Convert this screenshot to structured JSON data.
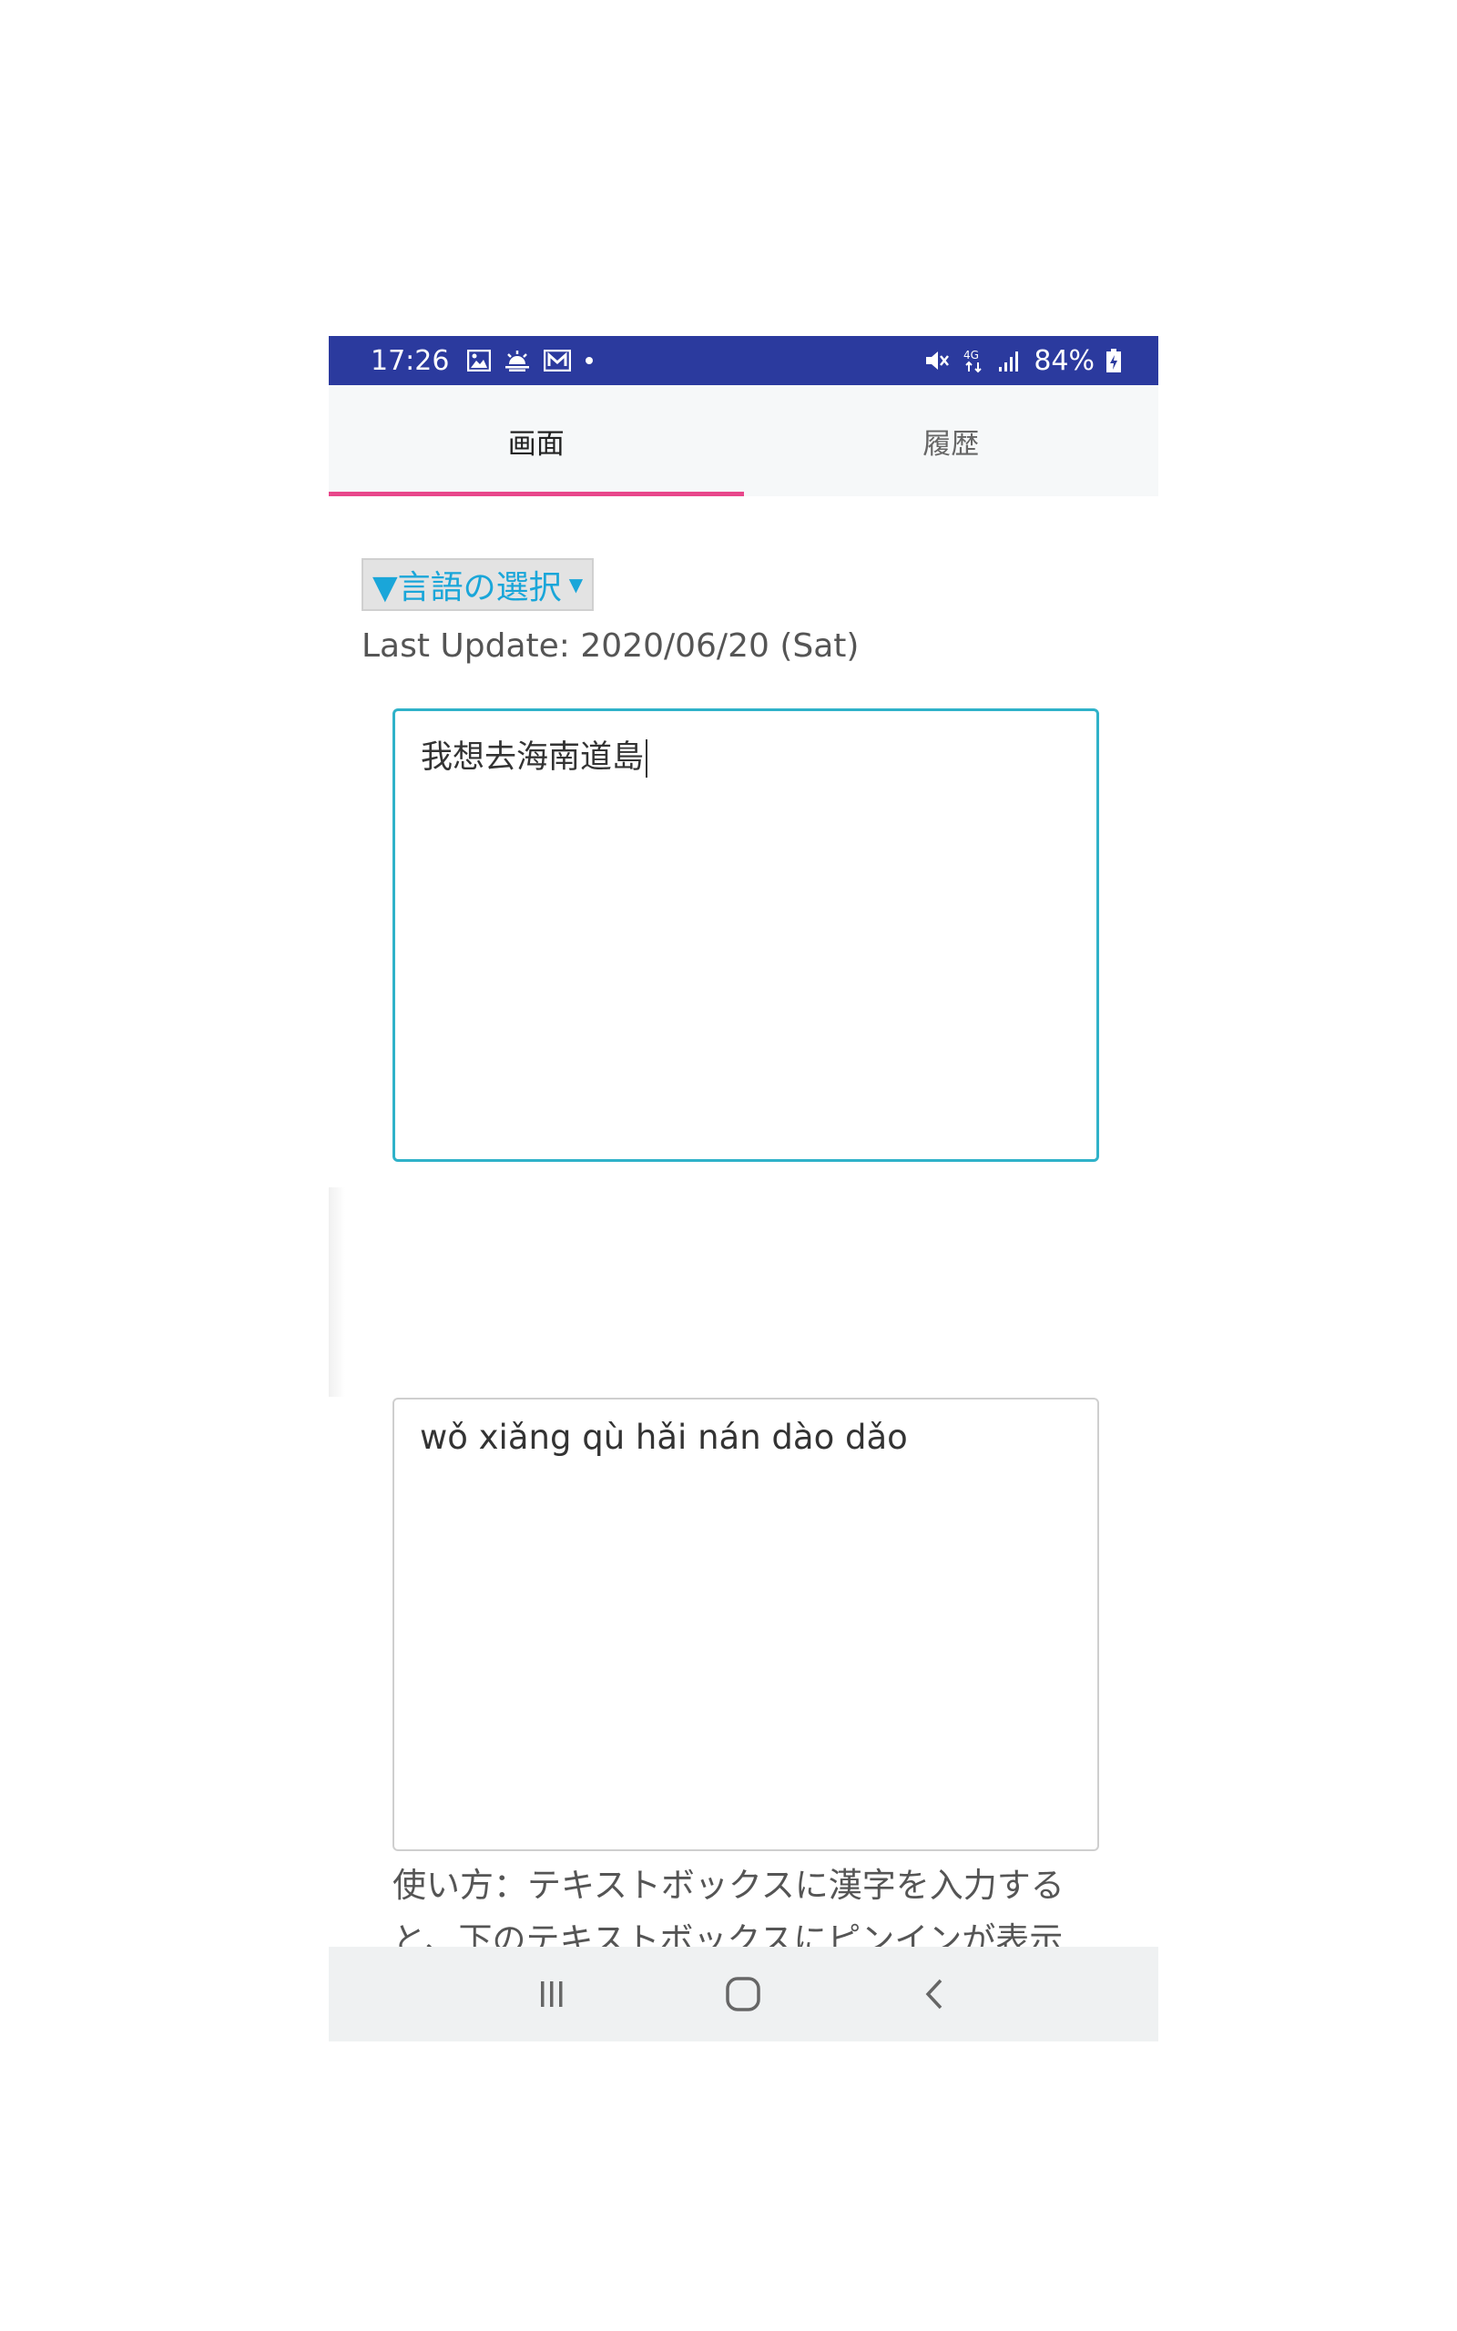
{
  "status_bar": {
    "time": "17:26",
    "battery": "84%",
    "network": "4G",
    "bg_color": "#2b3a9e",
    "icons_left": [
      "image-icon",
      "weather-icon",
      "mail-icon",
      "dot-icon"
    ],
    "icons_right": [
      "mute-icon",
      "network-4g-icon",
      "signal-icon",
      "battery-icon"
    ]
  },
  "tabs": [
    {
      "label": "画面",
      "active": true
    },
    {
      "label": "履歴",
      "active": false
    }
  ],
  "accent_color": "#e8478b",
  "language_select": {
    "label": "▼言語の選択"
  },
  "last_update": "Last Update: 2020/06/20 (Sat)",
  "input": {
    "value": "我想去海南道島"
  },
  "output": {
    "value": "wǒ xiǎng qù hǎi nán dào dǎo"
  },
  "usage": {
    "line1": "使い方：テキストボックスに漢字を入力する",
    "line2": "と、下のテキストボックスにピンインが表示"
  },
  "nav_bar": {
    "buttons": [
      "recent-apps-icon",
      "home-icon",
      "back-icon"
    ]
  }
}
